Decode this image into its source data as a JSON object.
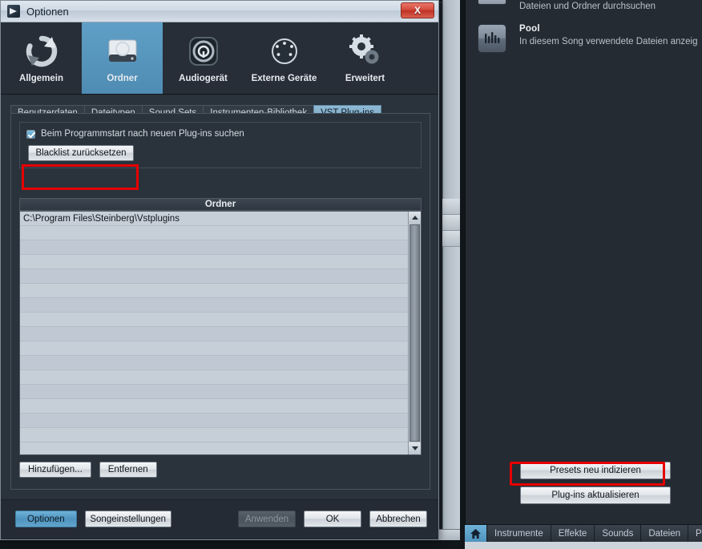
{
  "dialog": {
    "title": "Optionen",
    "title_icon": "app-logo-icon",
    "close_label": "X",
    "nav": [
      {
        "label": "Allgemein",
        "icon": "refresh-circle-icon",
        "selected": false
      },
      {
        "label": "Ordner",
        "icon": "hard-drive-icon",
        "selected": true
      },
      {
        "label": "Audiogerät",
        "icon": "audio-device-icon",
        "selected": false
      },
      {
        "label": "Externe Geräte",
        "icon": "midi-port-icon",
        "selected": false
      },
      {
        "label": "Erweitert",
        "icon": "gears-icon",
        "selected": false
      }
    ],
    "tabs": [
      {
        "label": "Benutzerdaten",
        "active": false
      },
      {
        "label": "Dateitypen",
        "active": false
      },
      {
        "label": "Sound Sets",
        "active": false
      },
      {
        "label": "Instrumenten-Bibliothek",
        "active": false
      },
      {
        "label": "VST Plug-ins",
        "active": true
      }
    ],
    "checkbox": {
      "label": "Beim Programmstart nach neuen Plug-ins suchen",
      "checked": true
    },
    "blacklist_button": "Blacklist zurücksetzen",
    "list_header": "Ordner",
    "folders": [
      "C:\\Program Files\\Steinberg\\Vstplugins"
    ],
    "empty_rows": 15,
    "add_button": "Hinzufügen...",
    "remove_button": "Entfernen",
    "footer": {
      "options": "Optionen",
      "song_settings": "Songeinstellungen",
      "apply": "Anwenden",
      "apply_disabled": true,
      "ok": "OK",
      "cancel": "Abbrechen"
    }
  },
  "right_panel": {
    "entries": [
      {
        "title": "",
        "subtitle": "Dateien und Ordner durchsuchen",
        "icon": "folder-browse-icon"
      },
      {
        "title": "Pool",
        "subtitle": "In diesem Song verwendete Dateien anzeig",
        "icon": "waveform-icon"
      }
    ],
    "buttons": [
      {
        "label": "Presets neu indizieren",
        "highlighted": true
      },
      {
        "label": "Plug-ins aktualisieren",
        "highlighted": false
      }
    ],
    "tabs": [
      {
        "label": "",
        "icon": "home-icon",
        "active": true
      },
      {
        "label": "Instrumente",
        "active": false
      },
      {
        "label": "Effekte",
        "active": false
      },
      {
        "label": "Sounds",
        "active": false
      },
      {
        "label": "Dateien",
        "active": false
      },
      {
        "label": "Pool",
        "active": false
      }
    ]
  },
  "colors": {
    "accent_blue": "#5f9fc6",
    "highlight_red": "#e60000",
    "dialog_bg": "#2a323b",
    "list_bg": "#c6ced8"
  }
}
